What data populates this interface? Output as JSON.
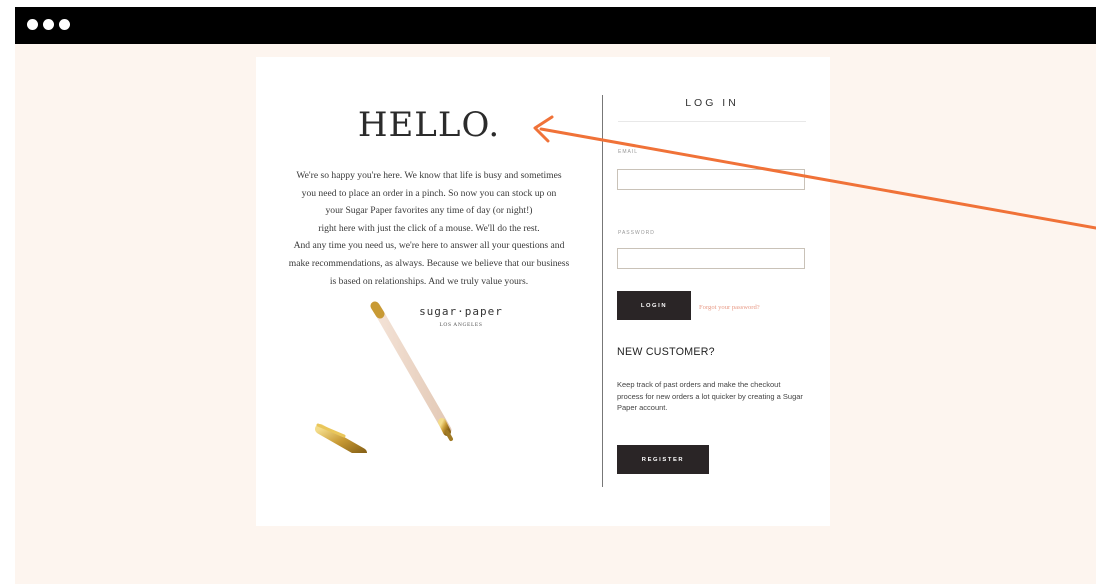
{
  "window": {
    "controls": [
      "dot",
      "dot",
      "dot"
    ]
  },
  "hello": {
    "heading": "HELLO.",
    "paragraph_lines": [
      "We're so happy you're here.  We know that life is busy and sometimes",
      "you need to place an order in a pinch. So now you can stock up on",
      "your Sugar Paper favorites any time of day (or night!)",
      "right here with just the click of a mouse. We'll do the rest.",
      "And any time you need us, we're here to answer all your questions and",
      "make recommendations, as always. Because we believe that our business",
      "is based on relationships. And we truly value yours."
    ],
    "brand_name": "sugar·paper",
    "brand_location": "LOS ANGELES"
  },
  "login": {
    "title": "LOG IN",
    "email_label": "EMAIL",
    "email_value": "",
    "password_label": "PASSWORD",
    "password_value": "",
    "login_button": "LOGIN",
    "forgot_link": "Forgot your password?"
  },
  "new_customer": {
    "title": "NEW CUSTOMER?",
    "text": "Keep track of past orders and make the checkout process for new orders a lot quicker by creating a Sugar Paper account.",
    "register_button": "REGISTER"
  },
  "colors": {
    "background": "#fdf5ef",
    "titlebar": "#000000",
    "button": "#2a2526",
    "link": "#e89a86",
    "annotation_arrow": "#f07238"
  }
}
